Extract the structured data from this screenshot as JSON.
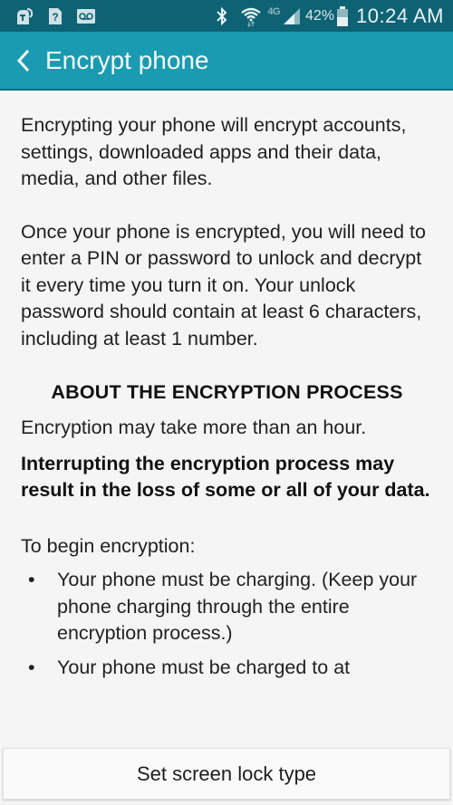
{
  "status_bar": {
    "left_icons": [
      "tmobile-app-icon",
      "sim-unknown-icon",
      "voicemail-icon"
    ],
    "right_icons": [
      "bluetooth-icon",
      "wifi-icon",
      "network-4g-icon",
      "signal-icon",
      "battery-icon"
    ],
    "network_label": "4G",
    "battery_percent": "42%",
    "time": "10:24 AM"
  },
  "colors": {
    "status_bar_bg": "#0d6274",
    "app_bar_bg": "#1a9bb1",
    "page_bg": "#f5f5f5"
  },
  "header": {
    "back_label": "Back",
    "title": "Encrypt phone"
  },
  "content": {
    "paragraphs": [
      "Encrypting your phone will encrypt accounts, settings, downloaded apps and their data, media, and other files.",
      "Once your phone is encrypted, you will need to enter a PIN or password to unlock and decrypt it every time you turn it on. Your unlock password should contain at least 6 characters, including at least 1 number."
    ],
    "section_heading": "ABOUT THE ENCRYPTION PROCESS",
    "info": "Encryption may take more than an hour.",
    "warning": "Interrupting the encryption process may result in the loss of some or all of your data.",
    "begin_label": "To begin encryption:",
    "requirements": [
      "Your phone must be charging. (Keep your phone charging through the entire encryption process.)",
      "Your phone must be charged to at"
    ],
    "bullet_glyph": "•"
  },
  "footer": {
    "button_label": "Set screen lock type"
  }
}
